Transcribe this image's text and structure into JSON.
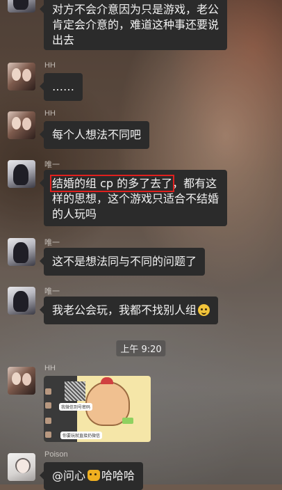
{
  "messages": [
    {
      "id": "m1",
      "sender": "",
      "lines": [
        "对方不会介意因为只是游戏，老公",
        "肯定会介意的，难道这种事还要说",
        "出去"
      ]
    },
    {
      "id": "m2",
      "sender": "HH",
      "text": "……"
    },
    {
      "id": "m3",
      "sender": "HH",
      "text": "每个人想法不同吧"
    },
    {
      "id": "m4",
      "sender": "唯一",
      "highlight": "结婚的组 cp 的多了去了",
      "line1_rest": "，都有这",
      "lines": [
        "样的思想，这个游戏只适合不结婚",
        "的人玩吗"
      ]
    },
    {
      "id": "m5",
      "sender": "唯一",
      "text": "这不是想法同与不同的问题了"
    },
    {
      "id": "m6",
      "sender": "唯一",
      "text": "我老公会玩，我都不找别人组",
      "emoji": "grin-emoji"
    },
    {
      "id": "m7",
      "sender": "HH",
      "image": {
        "caption_top": "我微信到号密码",
        "caption_bottom": "你要玩就直接扔微信"
      }
    },
    {
      "id": "m8",
      "sender": "Poison",
      "mention": "@问心",
      "text": "哈哈哈",
      "emoji": "cat-emoji"
    }
  ],
  "timestamp": "上午 9:20",
  "colors": {
    "bubble": "#2b2b2b",
    "highlight_border": "#e0201e"
  }
}
